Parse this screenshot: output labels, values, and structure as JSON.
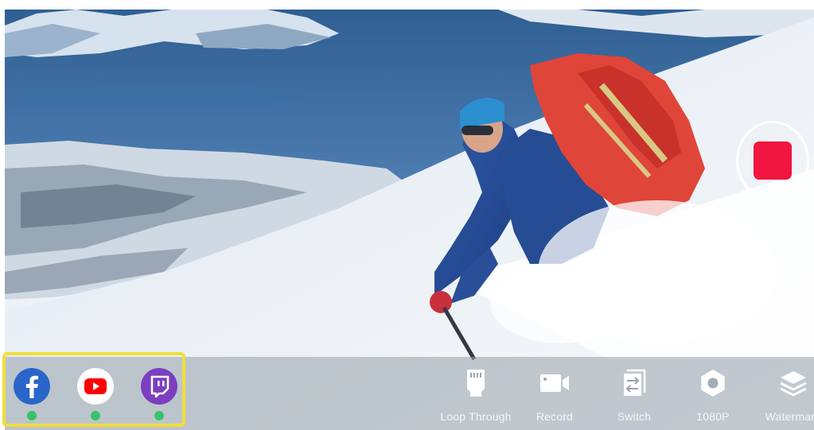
{
  "colors": {
    "highlight_border": "#f2de3a",
    "record_stop": "#f0163f",
    "facebook": "#2a66c9",
    "youtube": "#ff0000",
    "twitch": "#7b3fbf",
    "status_active": "#35c46a"
  },
  "record_button": {
    "icon": "stop-icon",
    "state": "recording"
  },
  "platforms": [
    {
      "name": "facebook",
      "icon": "facebook-icon",
      "status": "active"
    },
    {
      "name": "youtube",
      "icon": "youtube-icon",
      "status": "active"
    },
    {
      "name": "twitch",
      "icon": "twitch-icon",
      "status": "active"
    }
  ],
  "toolbar": {
    "loop_through": {
      "label": "Loop Through",
      "icon": "sd-card-icon"
    },
    "record": {
      "label": "Record",
      "icon": "video-camera-icon"
    },
    "switch": {
      "label": "Switch",
      "icon": "switch-icon"
    },
    "resolution": {
      "label": "1080P",
      "icon": "gear-icon"
    },
    "watermark": {
      "label": "Watermark",
      "icon": "layers-icon"
    }
  }
}
